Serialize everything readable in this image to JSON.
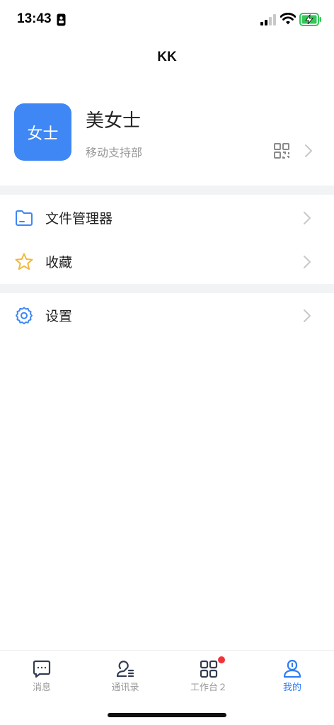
{
  "status_bar": {
    "time": "13:43"
  },
  "nav": {
    "title": "KK"
  },
  "profile": {
    "avatar_text": "女士",
    "name": "美女士",
    "department": "移动支持部"
  },
  "menu": [
    {
      "label": "文件管理器",
      "icon": "folder-icon"
    },
    {
      "label": "收藏",
      "icon": "star-icon"
    },
    {
      "label": "设置",
      "icon": "gear-icon"
    }
  ],
  "tabs": [
    {
      "label": "消息",
      "icon": "message-icon",
      "active": false
    },
    {
      "label": "通讯录",
      "icon": "contacts-icon",
      "active": false
    },
    {
      "label": "工作台２",
      "icon": "workbench-icon",
      "active": false,
      "badge": true
    },
    {
      "label": "我的",
      "icon": "profile-icon",
      "active": true
    }
  ],
  "colors": {
    "accent": "#2f7cf6",
    "avatar_bg": "#3f87f5",
    "badge": "#f2323a",
    "star": "#f2b93b",
    "separator": "#f2f3f5"
  }
}
